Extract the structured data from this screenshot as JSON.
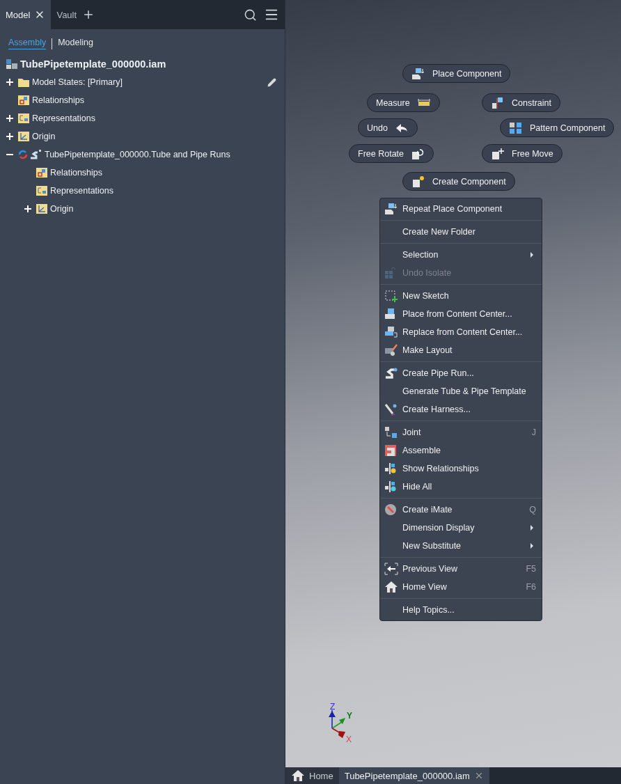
{
  "panel_tabs": [
    {
      "label": "Model",
      "selected": true,
      "closable": true
    },
    {
      "label": "Vault",
      "selected": false,
      "closable": false
    }
  ],
  "view_switch": [
    {
      "label": "Assembly",
      "selected": true
    },
    {
      "label": "Modeling",
      "selected": false
    }
  ],
  "tree": {
    "label": "TubePipetemplate_000000.iam",
    "kind": "assembly",
    "children": [
      {
        "label": "Model States: [Primary]",
        "kind": "folder",
        "expanded": false,
        "editable": true
      },
      {
        "label": "Relationships",
        "kind": "relationships"
      },
      {
        "label": "Representations",
        "kind": "representations",
        "expanded": false
      },
      {
        "label": "Origin",
        "kind": "origin",
        "expanded": false
      },
      {
        "label": "TubePipetemplate_000000.Tube and Pipe Runs",
        "kind": "runs",
        "expanded": true,
        "children": [
          {
            "label": "Relationships",
            "kind": "relationships"
          },
          {
            "label": "Representations",
            "kind": "representations"
          },
          {
            "label": "Origin",
            "kind": "origin",
            "expanded": false
          }
        ]
      }
    ]
  },
  "marking_menu": [
    {
      "label": "Place Component",
      "kind": "place"
    },
    {
      "label": "Measure",
      "kind": "measure"
    },
    {
      "label": "Constraint",
      "kind": "constraint"
    },
    {
      "label": "Undo",
      "kind": "undo"
    },
    {
      "label": "Pattern Component",
      "kind": "pattern"
    },
    {
      "label": "Free Rotate",
      "kind": "rotate"
    },
    {
      "label": "Free Move",
      "kind": "move"
    },
    {
      "label": "Create Component",
      "kind": "create"
    }
  ],
  "context_menu": {
    "groups": [
      [
        {
          "label": "Repeat Place Component",
          "kind": "place",
          "disabled": false,
          "submenu": false
        }
      ],
      [
        {
          "label": "Create New Folder",
          "kind": "none",
          "disabled": false,
          "submenu": false
        }
      ],
      [
        {
          "label": "Selection",
          "kind": "none",
          "disabled": false,
          "submenu": true
        },
        {
          "label": "Undo Isolate",
          "kind": "isolate",
          "disabled": true,
          "submenu": false
        }
      ],
      [
        {
          "label": "New Sketch",
          "kind": "sketch",
          "disabled": false,
          "submenu": false
        },
        {
          "label": "Place from Content Center...",
          "kind": "content",
          "disabled": false,
          "submenu": false
        },
        {
          "label": "Replace from Content Center...",
          "kind": "replace",
          "disabled": false,
          "submenu": false
        },
        {
          "label": "Make Layout",
          "kind": "layout",
          "disabled": false,
          "submenu": false
        }
      ],
      [
        {
          "label": "Create Pipe Run...",
          "kind": "pipe",
          "disabled": false,
          "submenu": false
        },
        {
          "label": "Generate Tube & Pipe Template",
          "kind": "none",
          "disabled": false,
          "submenu": false
        },
        {
          "label": "Create Harness...",
          "kind": "harness",
          "disabled": false,
          "submenu": false
        }
      ],
      [
        {
          "label": "Joint",
          "kind": "joint",
          "shortcut": "J",
          "disabled": false,
          "submenu": false
        },
        {
          "label": "Assemble",
          "kind": "assemble",
          "disabled": false,
          "submenu": false
        },
        {
          "label": "Show Relationships",
          "kind": "showrel",
          "disabled": false,
          "submenu": false
        },
        {
          "label": "Hide All",
          "kind": "hideall",
          "disabled": false,
          "submenu": false
        }
      ],
      [
        {
          "label": "Create iMate",
          "kind": "imate",
          "shortcut": "Q",
          "disabled": false,
          "submenu": false
        },
        {
          "label": "Dimension Display",
          "kind": "none",
          "disabled": false,
          "submenu": true
        },
        {
          "label": "New Substitute",
          "kind": "none",
          "disabled": false,
          "submenu": true
        }
      ],
      [
        {
          "label": "Previous View",
          "kind": "previous",
          "shortcut": "F5",
          "disabled": false,
          "submenu": false
        },
        {
          "label": "Home View",
          "kind": "home",
          "shortcut": "F6",
          "disabled": false,
          "submenu": false
        }
      ],
      [
        {
          "label": "Help Topics...",
          "kind": "none",
          "disabled": false,
          "submenu": false
        }
      ]
    ]
  },
  "axes": {
    "x": "X",
    "y": "Y",
    "z": "Z"
  },
  "document_tabs": [
    {
      "label": "Home",
      "kind": "home",
      "selected": false,
      "closable": false
    },
    {
      "label": "TubePipetemplate_000000.iam",
      "kind": "file",
      "selected": true,
      "closable": true
    }
  ]
}
